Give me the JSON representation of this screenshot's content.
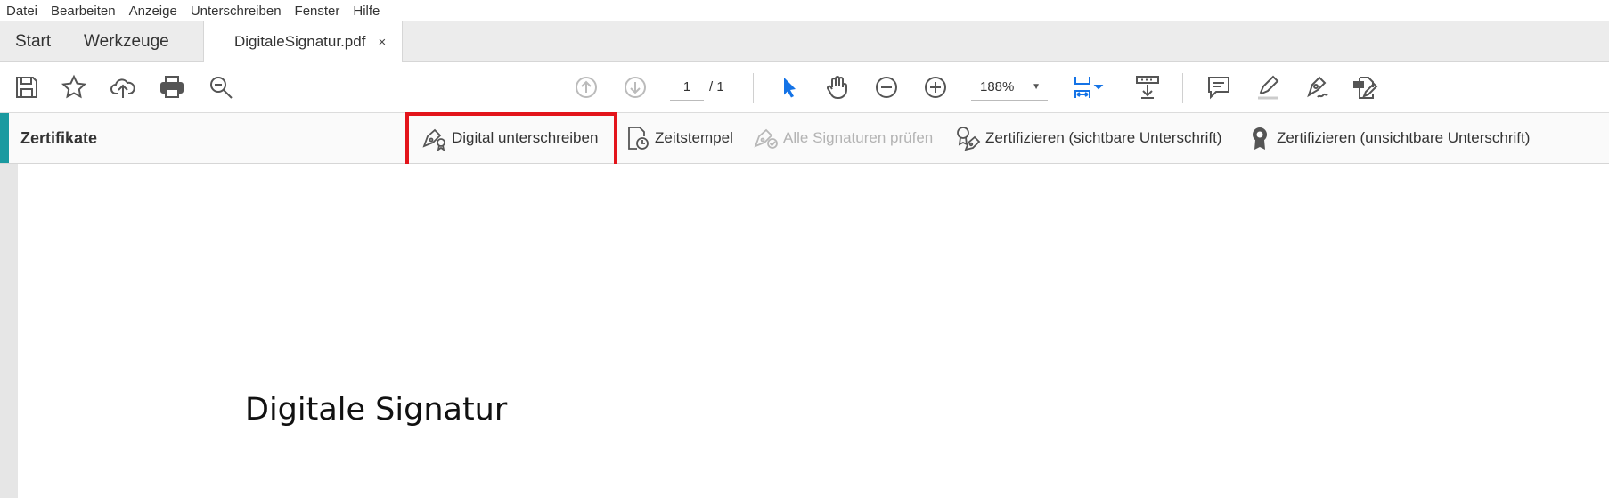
{
  "menu": [
    "Datei",
    "Bearbeiten",
    "Anzeige",
    "Unterschreiben",
    "Fenster",
    "Hilfe"
  ],
  "tabs": {
    "start": "Start",
    "tools": "Werkzeuge",
    "document": "DigitaleSignatur.pdf",
    "close_glyph": "×"
  },
  "toolbar": {
    "page_current": "1",
    "page_total": "/ 1",
    "zoom": "188%",
    "icons": [
      "save-icon",
      "bookmark-star-icon",
      "upload-cloud-icon",
      "print-icon",
      "search-zoom-icon",
      "page-up-icon",
      "page-down-icon",
      "select-cursor-icon",
      "hand-icon",
      "zoom-out-icon",
      "zoom-in-icon",
      "fit-page-icon",
      "scroll-mode-icon",
      "comment-icon",
      "highlight-icon",
      "sign-icon",
      "edit-pdf-icon"
    ],
    "accent": "#1473e6"
  },
  "certbar": {
    "title": "Zertifikate",
    "digital_sign": "Digital unterschreiben",
    "timestamp": "Zeitstempel",
    "verify_all": "Alle Signaturen prüfen",
    "certify_visible": "Zertifizieren (sichtbare Unterschrift)",
    "certify_invisible": "Zertifizieren (unsichtbare Unterschrift)",
    "accent": "#1a9aa0",
    "highlight_color": "#e3141b"
  },
  "document": {
    "heading": "Digitale Signatur"
  }
}
